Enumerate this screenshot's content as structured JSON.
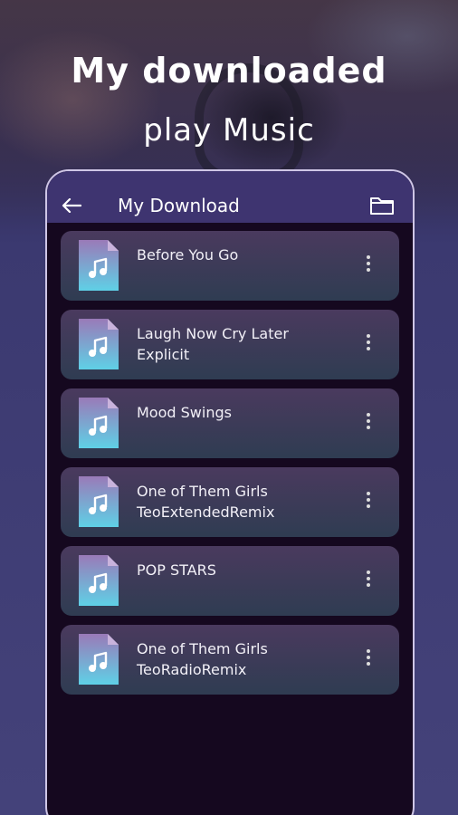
{
  "promo": {
    "line1": "My downloaded",
    "line2": "play Music"
  },
  "appbar": {
    "title": "My Download",
    "back_icon": "arrow-left-icon",
    "folder_icon": "folder-icon"
  },
  "songs": [
    {
      "title": "Before You Go"
    },
    {
      "title": "Laugh Now Cry Later\nExplicit"
    },
    {
      "title": "Mood Swings"
    },
    {
      "title": "One of Them Girls\nTeoExtendedRemix"
    },
    {
      "title": "POP STARS"
    },
    {
      "title": "One of Them Girls\nTeoRadioRemix"
    }
  ],
  "colors": {
    "appbar": "#3e3470",
    "icon_gradient_top": "#9a7ab8",
    "icon_gradient_bottom": "#5fd0e6"
  }
}
